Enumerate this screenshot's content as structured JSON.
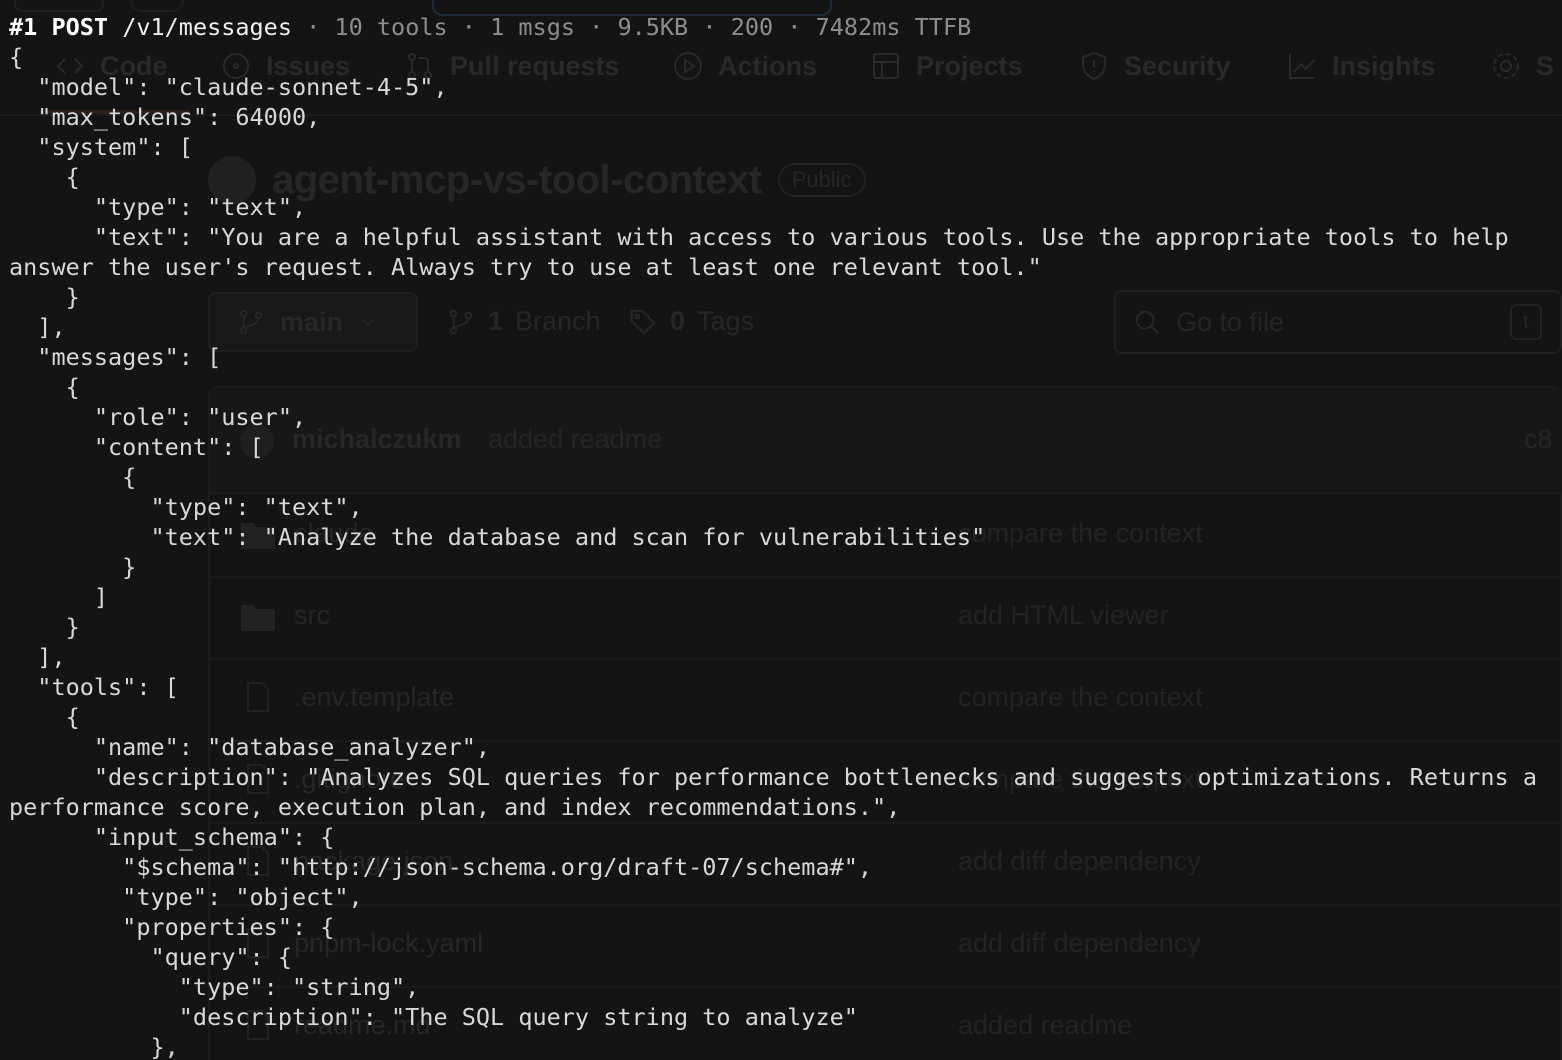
{
  "request_header": {
    "id": "#1",
    "method": "POST",
    "path": "/v1/messages",
    "tools": "10 tools",
    "msgs": "1 msgs",
    "size": "9.5KB",
    "status": "200",
    "ttfb": "7482ms TTFB",
    "separator": "·"
  },
  "code_lines": [
    "{",
    "  \"model\": \"claude-sonnet-4-5\",",
    "  \"max_tokens\": 64000,",
    "  \"system\": [",
    "    {",
    "      \"type\": \"text\",",
    "      \"text\": \"You are a helpful assistant with access to various tools. Use the appropriate tools to help",
    "answer the user's request. Always try to use at least one relevant tool.\"",
    "    }",
    "  ],",
    "  \"messages\": [",
    "    {",
    "      \"role\": \"user\",",
    "      \"content\": [",
    "        {",
    "          \"type\": \"text\",",
    "          \"text\": \"Analyze the database and scan for vulnerabilities\"",
    "        }",
    "      ]",
    "    }",
    "  ],",
    "  \"tools\": [",
    "    {",
    "      \"name\": \"database_analyzer\",",
    "      \"description\": \"Analyzes SQL queries for performance bottlenecks and suggests optimizations. Returns a",
    "performance score, execution plan, and index recommendations.\",",
    "      \"input_schema\": {",
    "        \"$schema\": \"http://json-schema.org/draft-07/schema#\",",
    "        \"type\": \"object\",",
    "        \"properties\": {",
    "          \"query\": {",
    "            \"type\": \"string\",",
    "            \"description\": \"The SQL query string to analyze\"",
    "          },"
  ],
  "background": {
    "tabs": [
      {
        "label": "Code",
        "icon": "code-icon"
      },
      {
        "label": "Issues",
        "icon": "issue-icon"
      },
      {
        "label": "Pull requests",
        "icon": "pull-request-icon"
      },
      {
        "label": "Actions",
        "icon": "play-icon"
      },
      {
        "label": "Projects",
        "icon": "table-icon"
      },
      {
        "label": "Security",
        "icon": "shield-icon"
      },
      {
        "label": "Insights",
        "icon": "graph-icon"
      },
      {
        "label": "S",
        "icon": "gear-icon"
      }
    ],
    "repo_name": "agent-mcp-vs-tool-context",
    "visibility": "Public",
    "branch": "main",
    "branches": {
      "count": "1",
      "label": "Branch"
    },
    "tags": {
      "count": "0",
      "label": "Tags"
    },
    "search_placeholder": "Go to file",
    "search_shortcut": "t",
    "latest_commit": {
      "author": "michalczukm",
      "message": "added readme",
      "hash": "c8"
    },
    "files": [
      {
        "name": "claude",
        "type": "folder",
        "commit": "compare the context"
      },
      {
        "name": "src",
        "type": "folder",
        "commit": "add HTML viewer"
      },
      {
        "name": ".env.template",
        "type": "file",
        "commit": "compare the context"
      },
      {
        "name": ".gitignore",
        "type": "file",
        "commit": "compare the context"
      },
      {
        "name": "package.json",
        "type": "file",
        "commit": "add diff dependency"
      },
      {
        "name": "pnpm-lock.yaml",
        "type": "file",
        "commit": "add diff dependency"
      },
      {
        "name": "readme.md",
        "type": "file",
        "commit": "added readme"
      }
    ]
  }
}
